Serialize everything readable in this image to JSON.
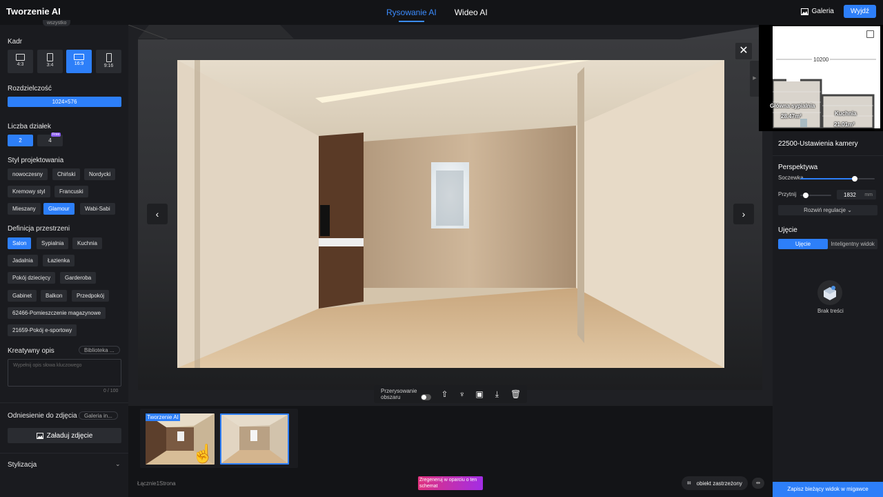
{
  "app": {
    "title": "Tworzenie AI"
  },
  "top_tabs": [
    {
      "label": "Rysowanie AI",
      "active": true
    },
    {
      "label": "Wideo AI",
      "active": false
    }
  ],
  "top_right": {
    "gallery_label": "Galeria",
    "exit_label": "Wyjdź"
  },
  "sidebar": {
    "scroll_hint": "wszystko",
    "frame": {
      "title": "Kadr",
      "options": [
        {
          "label": "4:3",
          "selected": false
        },
        {
          "label": "3:4",
          "selected": false
        },
        {
          "label": "16:9",
          "selected": true
        },
        {
          "label": "9:16",
          "selected": false
        }
      ]
    },
    "resolution": {
      "title": "Rozdzielczość",
      "value": "1024×576"
    },
    "count": {
      "title": "Liczba działek",
      "options": [
        {
          "label": "2",
          "selected": true
        },
        {
          "label": "4",
          "selected": false,
          "badge": "Free"
        }
      ]
    },
    "style": {
      "title": "Styl projektowania",
      "options": [
        "nowoczesny",
        "Chiński",
        "Nordycki",
        "Kremowy styl",
        "Francuski",
        "Mieszany",
        "Glamour",
        "Wabi-Sabi"
      ],
      "selected": "Glamour"
    },
    "space": {
      "title": "Definicja przestrzeni",
      "options": [
        "Salon",
        "Sypialnia",
        "Kuchnia",
        "Jadalnia",
        "Łazienka",
        "Pokój dziecięcy",
        "Garderoba",
        "Gabinet",
        "Balkon",
        "Przedpokój",
        "62466-Pomieszczenie magazynowe",
        "21659-Pokój e-sportowy"
      ],
      "selected": "Salon"
    },
    "creative": {
      "title": "Kreatywny opis",
      "library_label": "Biblioteka ...",
      "placeholder": "Wypełnij opis słowa kluczowego",
      "counter": "0 / 100"
    },
    "reference": {
      "title": "Odniesienie do zdjęcia",
      "gallery_label": "Galeria in...",
      "upload_label": "Załaduj zdjęcie"
    },
    "stylization": {
      "title": "Stylizacja"
    }
  },
  "canvas": {
    "redraw_label_1": "Przerysowanie",
    "redraw_label_2": "obszaru",
    "redraw_enabled": false,
    "tools": [
      "upload-icon",
      "clean-icon",
      "save-icon",
      "download-icon",
      "delete-icon"
    ]
  },
  "thumbnails": {
    "label": "Tworzenie AI",
    "items": [
      {
        "selected": false
      },
      {
        "selected": true
      }
    ],
    "page_count": "Łącznie1Strona"
  },
  "bottom": {
    "regen_label": "Zregeneruj w oparciu o ten schemat",
    "reserved_label": "obiekt zastrzeżony"
  },
  "right_panel": {
    "minimap": {
      "dimension": "10200",
      "rooms": [
        {
          "name": "Główna sypialnia",
          "area": "28.47m²"
        },
        {
          "name": "Kuchnia",
          "area": "21.01m²"
        }
      ]
    },
    "camera_title": "22500-Ustawienia kamery",
    "perspective": {
      "title": "Perspektywa",
      "lens_label": "Soczewka",
      "lens_level": 0.73,
      "clip_label": "Przytnij",
      "clip_value": "1832",
      "clip_unit": "mm",
      "expand_label": "Rozwiń regulacje"
    },
    "shot": {
      "title": "Ujęcie",
      "tabs": [
        {
          "label": "Ujęcie",
          "selected": true
        },
        {
          "label": "Inteligentny widok",
          "selected": false
        }
      ],
      "empty_label": "Brak treści"
    },
    "save_label": "Zapisz bieżący widok w migawce"
  },
  "colors": {
    "accent": "#2d7ff9",
    "background": "#131417",
    "panel": "#1a1b1f"
  }
}
